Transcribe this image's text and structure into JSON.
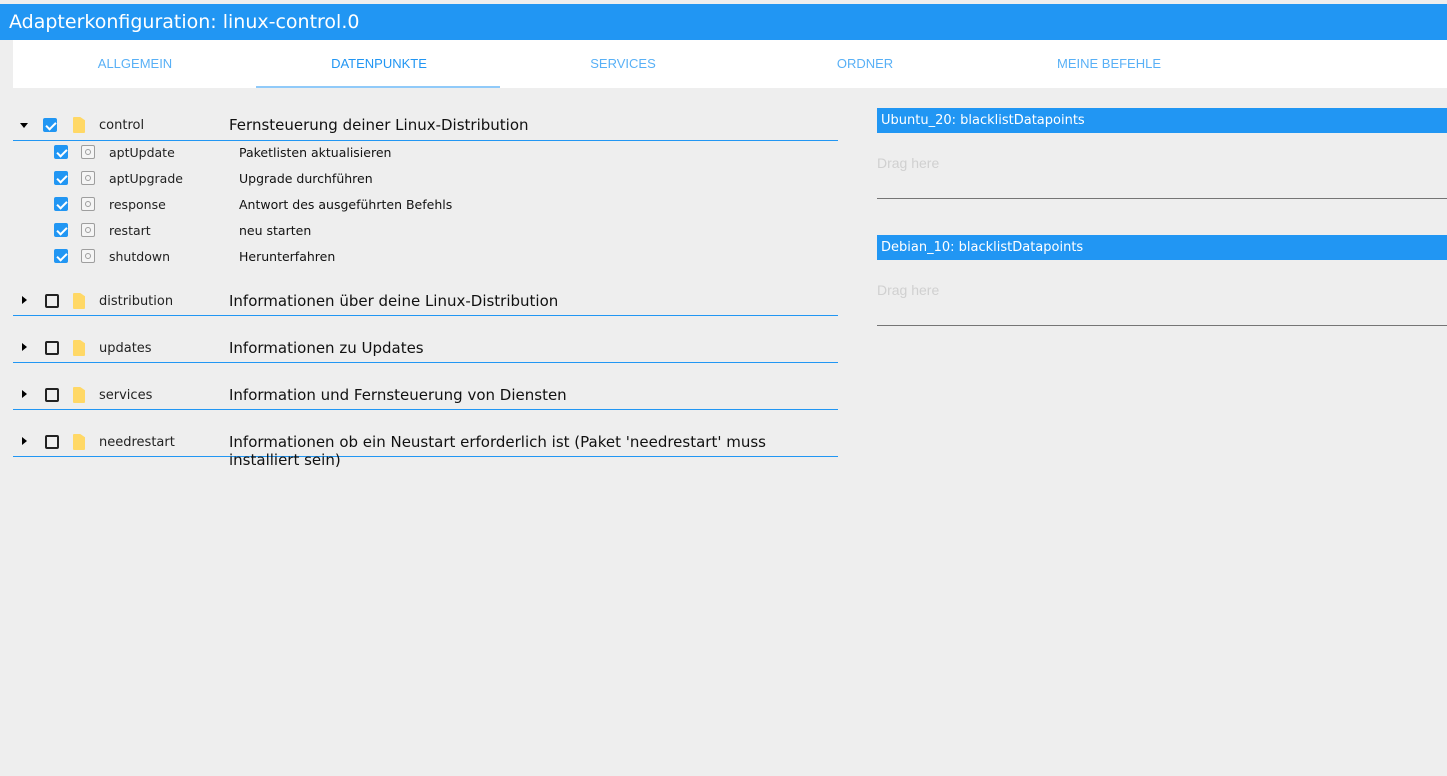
{
  "window": {
    "title": "Adapterkonfiguration: linux-control.0"
  },
  "tabs": [
    {
      "label": "ALLGEMEIN",
      "active": false
    },
    {
      "label": "DATENPUNKTE",
      "active": true
    },
    {
      "label": "SERVICES",
      "active": false
    },
    {
      "label": "ORDNER",
      "active": false
    },
    {
      "label": "MEINE BEFEHLE",
      "active": false
    }
  ],
  "tree": {
    "folders": [
      {
        "name": "control",
        "description": "Fernsteuerung deiner Linux-Distribution",
        "expanded": true,
        "checked": true,
        "items": [
          {
            "name": "aptUpdate",
            "description": "Paketlisten aktualisieren",
            "checked": true
          },
          {
            "name": "aptUpgrade",
            "description": "Upgrade durchführen",
            "checked": true
          },
          {
            "name": "response",
            "description": "Antwort des ausgeführten Befehls",
            "checked": true
          },
          {
            "name": "restart",
            "description": "neu starten",
            "checked": true
          },
          {
            "name": "shutdown",
            "description": "Herunterfahren",
            "checked": true
          }
        ]
      },
      {
        "name": "distribution",
        "description": "Informationen über deine Linux-Distribution",
        "expanded": false,
        "checked": false
      },
      {
        "name": "updates",
        "description": "Informationen zu Updates",
        "expanded": false,
        "checked": false
      },
      {
        "name": "services",
        "description": "Information und Fernsteuerung von Diensten",
        "expanded": false,
        "checked": false
      },
      {
        "name": "needrestart",
        "description": "Informationen ob ein Neustart erforderlich ist (Paket 'needrestart' muss installiert sein)",
        "expanded": false,
        "checked": false
      }
    ]
  },
  "blacklists": [
    {
      "header": "Ubuntu_20: blacklistDatapoints",
      "placeholder": "Drag here"
    },
    {
      "header": "Debian_10: blacklistDatapoints",
      "placeholder": "Drag here"
    }
  ],
  "colors": {
    "accent": "#2196f3",
    "folder": "#ffd866",
    "background": "#eeeeee"
  }
}
